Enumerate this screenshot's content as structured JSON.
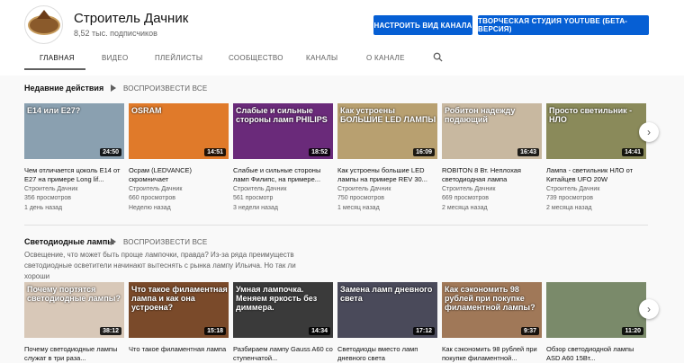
{
  "channel": {
    "title": "Строитель Дачник",
    "subscribers": "8,52 тыс. подписчиков"
  },
  "buttons": {
    "customize": "НАСТРОИТЬ ВИД КАНАЛА",
    "studio": "ТВОРЧЕСКАЯ СТУДИЯ YOUTUBE (БЕТА-ВЕРСИЯ)"
  },
  "tabs": [
    "ГЛАВНАЯ",
    "ВИДЕО",
    "ПЛЕЙЛИСТЫ",
    "СООБЩЕСТВО",
    "КАНАЛЫ",
    "О КАНАЛЕ"
  ],
  "icons": {
    "search": "search-icon",
    "play": "play-icon",
    "next": "chevron-right-icon"
  },
  "sections": [
    {
      "title": "Недавние действия",
      "play_all": "ВОСПРОИЗВЕСТИ ВСЕ",
      "videos": [
        {
          "thumb_text": "E14 или E27?",
          "duration": "24:50",
          "title": "Чем отличается цоколь E14 от E27 на примере Long lif...",
          "channel": "Строитель Дачник",
          "views": "356 просмотров",
          "date": "1 день назад",
          "bg": "#8aa0b0"
        },
        {
          "thumb_text": "OSRAM",
          "duration": "14:51",
          "title": "Осрам (LEDVANCE) скромничает",
          "channel": "Строитель Дачник",
          "views": "660 просмотров",
          "date": "Неделю назад",
          "bg": "#e07a2a"
        },
        {
          "thumb_text": "Слабые и сильные стороны ламп PHILIPS",
          "duration": "18:52",
          "title": "Слабые и сильные стороны ламп Филипс, на примере...",
          "channel": "Строитель Дачник",
          "views": "561 просмотр",
          "date": "3 недели назад",
          "bg": "#6a2a7a"
        },
        {
          "thumb_text": "Как устроены БОЛЬШИЕ LED ЛАМПЫ",
          "duration": "16:09",
          "title": "Как устроены большие LED лампы на примере REV 30...",
          "channel": "Строитель Дачник",
          "views": "750 просмотров",
          "date": "1 месяц назад",
          "bg": "#b8a070"
        },
        {
          "thumb_text": "Робитон надежду подающий",
          "duration": "16:43",
          "title": "ROBITON 8 Вт. Неплохая светодиодная лампа",
          "channel": "Строитель Дачник",
          "views": "669 просмотров",
          "date": "2 месяца назад",
          "bg": "#c8b8a0"
        },
        {
          "thumb_text": "Просто светильник - НЛО",
          "duration": "14:41",
          "title": "Лампа - светильник НЛО от Китайцев UFO 20W",
          "channel": "Строитель Дачник",
          "views": "739 просмотров",
          "date": "2 месяца назад",
          "bg": "#8a8a5a"
        }
      ]
    },
    {
      "title": "Светодиодные лампы",
      "play_all": "ВОСПРОИЗВЕСТИ ВСЕ",
      "description": "Освещение, что может быть проще лампочки, правда? Из-за ряда преимуществ светодиодные осветители начинают вытеснять с рынка лампу Ильича. Но так ли хороши",
      "videos": [
        {
          "thumb_text": "Почему портятся светодиодные лампы?",
          "duration": "38:12",
          "title": "Почему светодиодные лампы служат в три раза...",
          "bg": "#d8c8b8"
        },
        {
          "thumb_text": "Что такое филаментная лампа и как она устроена?",
          "duration": "15:18",
          "title": "Что такое филаментная лампа",
          "bg": "#7a4a2a"
        },
        {
          "thumb_text": "Умная лампочка. Меняем яркость без диммера.",
          "duration": "14:34",
          "title": "Разбираем лампу Gauss A60 со ступенчатой...",
          "bg": "#3a3a3a"
        },
        {
          "thumb_text": "Замена ламп дневного света",
          "duration": "17:12",
          "title": "Светодиоды вместо ламп дневного света",
          "bg": "#4a4a5a"
        },
        {
          "thumb_text": "Как сэкономить 98 рублей при покупке филаментной лампы?",
          "duration": "9:37",
          "title": "Как сэкономить 98 рублей при покупке филаментной...",
          "bg": "#a07858"
        },
        {
          "thumb_text": "",
          "duration": "11:20",
          "title": "Обзор светодиодной лампы ASD A60 15Вт...",
          "bg": "#7a8a6a"
        }
      ]
    }
  ]
}
